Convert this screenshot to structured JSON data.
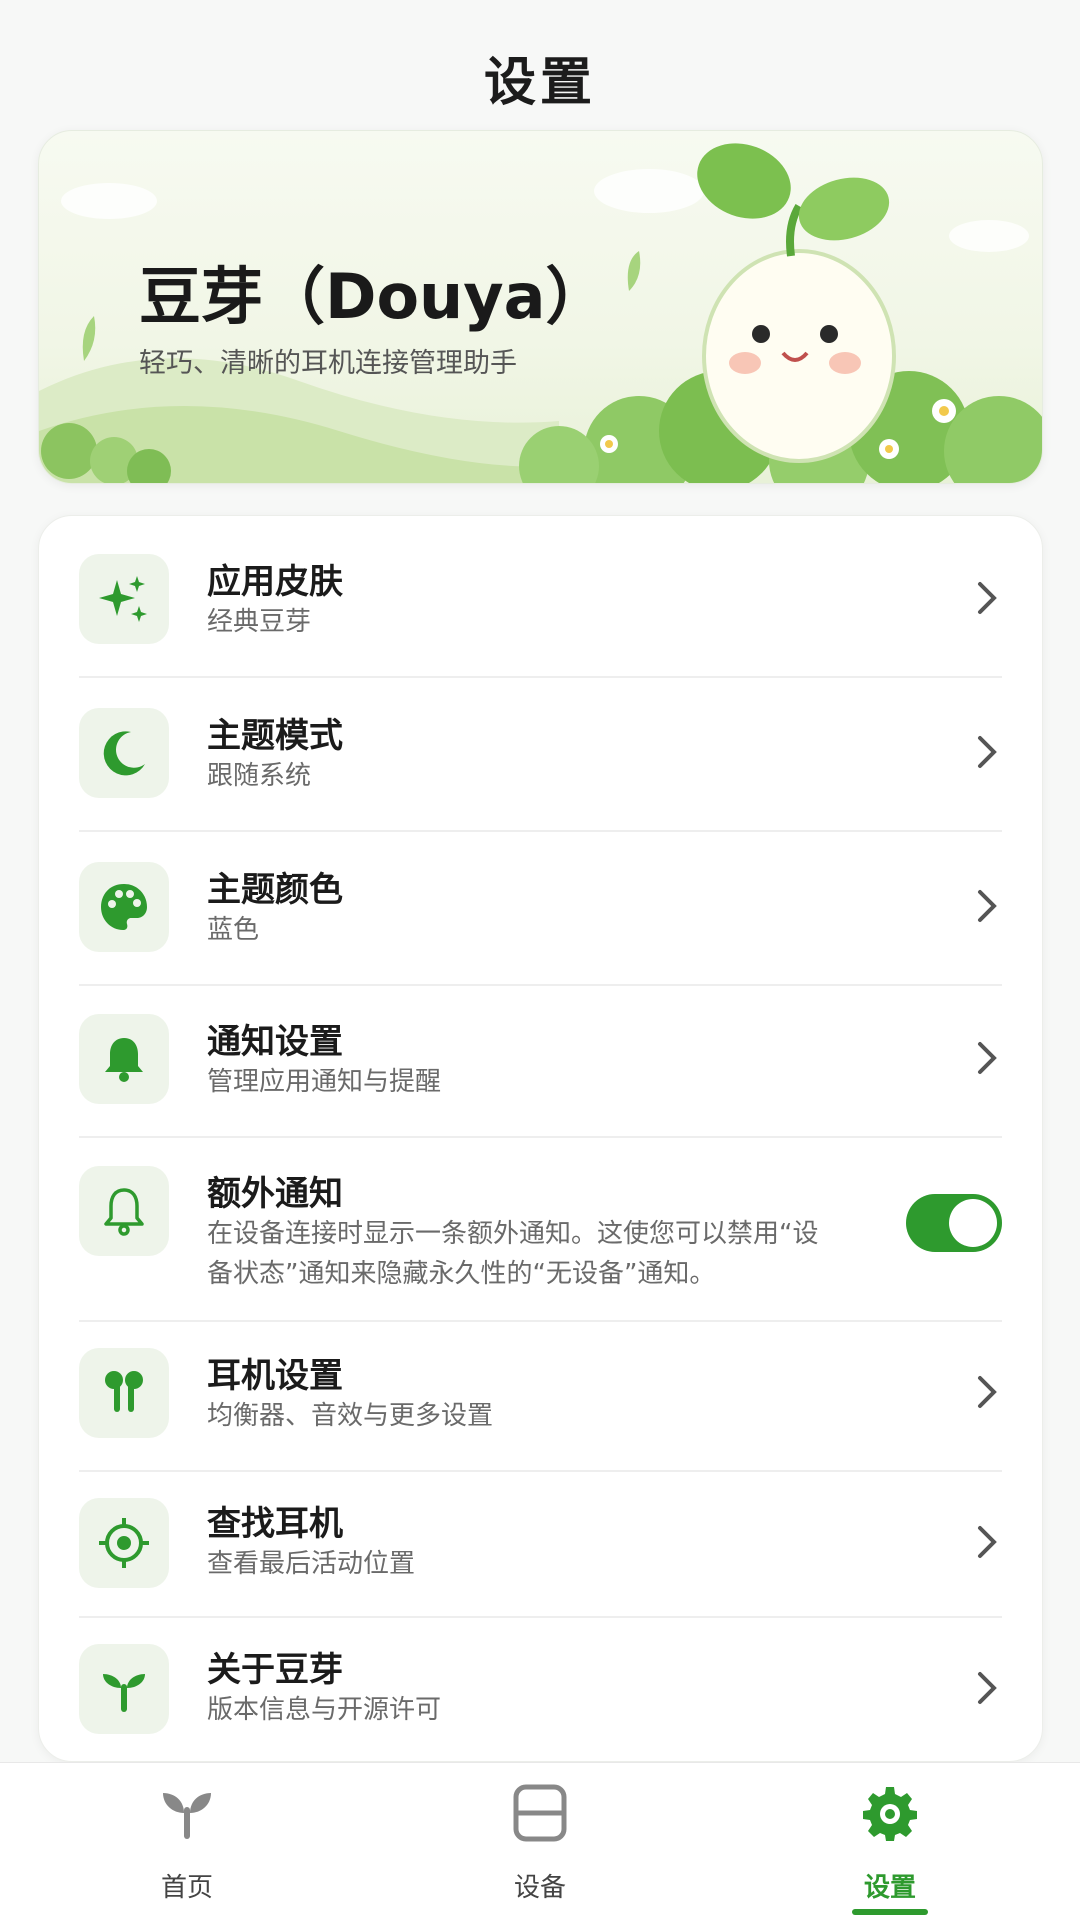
{
  "page": {
    "title": "设置"
  },
  "hero": {
    "title": "豆芽（Douya）",
    "subtitle": "轻巧、清晰的耳机连接管理助手"
  },
  "settings": [
    {
      "icon": "sparkle-icon",
      "title": "应用皮肤",
      "subtitle": "经典豆芽",
      "control": "chevron"
    },
    {
      "icon": "moon-icon",
      "title": "主题模式",
      "subtitle": "跟随系统",
      "control": "chevron"
    },
    {
      "icon": "palette-icon",
      "title": "主题颜色",
      "subtitle": "蓝色",
      "control": "chevron"
    },
    {
      "icon": "bell-icon",
      "title": "通知设置",
      "subtitle": "管理应用通知与提醒",
      "control": "chevron"
    },
    {
      "icon": "bell-outline-icon",
      "title": "额外通知",
      "subtitle_line1": "在设备连接时显示一条额外通知。这使您可以禁用“设",
      "subtitle_line2": "备状态”通知来隐藏永久性的“无设备”通知。",
      "control": "toggle",
      "toggle_on": true
    },
    {
      "icon": "earbuds-icon",
      "title": "耳机设置",
      "subtitle": "均衡器、音效与更多设置",
      "control": "chevron"
    },
    {
      "icon": "locate-icon",
      "title": "查找耳机",
      "subtitle": "查看最后活动位置",
      "control": "chevron"
    },
    {
      "icon": "sprout-icon",
      "title": "关于豆芽",
      "subtitle": "版本信息与开源许可",
      "control": "chevron"
    }
  ],
  "nav": {
    "home": "首页",
    "devices": "设备",
    "settings": "设置",
    "active": "settings"
  },
  "colors": {
    "accent": "#2e9a2e",
    "icon_bg": "#eef4ea",
    "background": "#f7f8f7"
  }
}
